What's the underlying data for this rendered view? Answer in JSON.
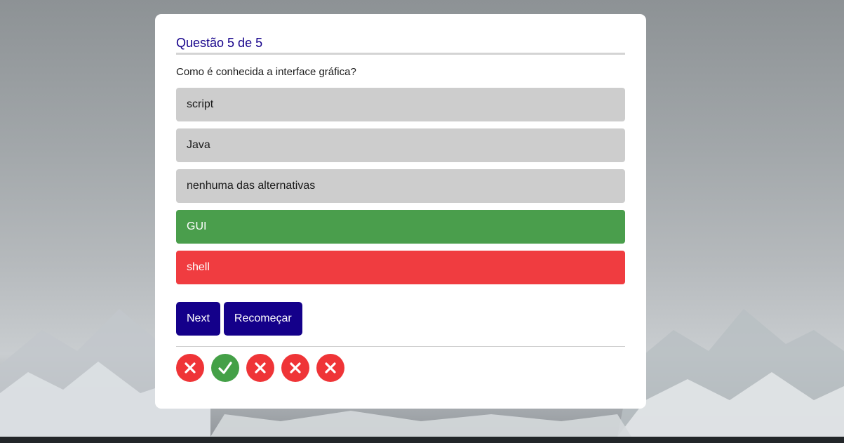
{
  "quiz": {
    "header": "Questão 5 de 5",
    "question": "Como é conhecida a interface gráfica?",
    "answers": [
      {
        "label": "script",
        "state": "neutral"
      },
      {
        "label": "Java",
        "state": "neutral"
      },
      {
        "label": "nenhuma das alternativas",
        "state": "neutral"
      },
      {
        "label": "GUI",
        "state": "correct"
      },
      {
        "label": "shell",
        "state": "wrong"
      }
    ],
    "buttons": {
      "next_label": "Next",
      "restart_label": "Recomeçar"
    },
    "results": [
      {
        "status": "wrong",
        "icon": "x-icon"
      },
      {
        "status": "correct",
        "icon": "check-icon"
      },
      {
        "status": "wrong",
        "icon": "x-icon"
      },
      {
        "status": "wrong",
        "icon": "x-icon"
      },
      {
        "status": "wrong",
        "icon": "x-icon"
      }
    ]
  },
  "colors": {
    "accent": "#14008a",
    "correct": "#4a9e4c",
    "wrong": "#f03c40",
    "neutral": "#cdcdcd"
  }
}
